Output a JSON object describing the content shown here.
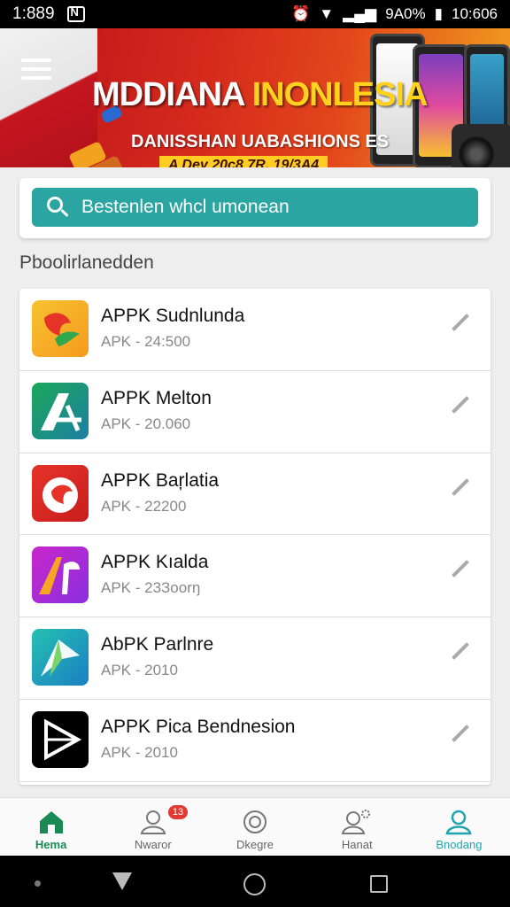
{
  "status_bar": {
    "time": "1:889",
    "battery_text": "9A0%",
    "clock_right": "10:606"
  },
  "banner": {
    "title_part1": "MDDIANA",
    "title_part2": "INONLESIA",
    "subtitle": "DANISSHAN UABASHIONS ES",
    "date_strip": "A Dey 20c8 7R. 19/3A4"
  },
  "search": {
    "placeholder": "Bestenlen whcl umonean",
    "icon": "search-icon"
  },
  "section_title": "Pboolirlanedden",
  "apps": [
    {
      "name": "APPK Sudnlunda",
      "meta": "APK - 24:500",
      "icon_colors": [
        "#f7c230",
        "#f59b1d"
      ]
    },
    {
      "name": "APPK Melton",
      "meta": "APK - 20.060",
      "icon_colors": [
        "#1ba85a",
        "#1d7fa2"
      ]
    },
    {
      "name": "APPK Baŗlatia",
      "meta": "APK - 22200",
      "icon_colors": [
        "#e63328",
        "#c81e1e"
      ]
    },
    {
      "name": "APPK Kıalda",
      "meta": "APK - 23Зoorŋ",
      "icon_colors": [
        "#c926c9",
        "#8a2fe0"
      ]
    },
    {
      "name": "AbPK Parlnre",
      "meta": "APK - 2010",
      "icon_colors": [
        "#25c0b0",
        "#1a7fc4"
      ]
    },
    {
      "name": "APPK Pica Bendnesion",
      "meta": "APK - 2010",
      "icon_colors": [
        "#000000",
        "#111111"
      ]
    }
  ],
  "bottom_nav": [
    {
      "label": "Hema",
      "icon": "home-icon"
    },
    {
      "label": "Nwaror",
      "icon": "user-badge-icon"
    },
    {
      "label": "Dkegre",
      "icon": "clock-icon"
    },
    {
      "label": "Hanat",
      "icon": "user-settings-icon"
    },
    {
      "label": "Bnodang",
      "icon": "user-icon"
    }
  ],
  "badge_count": "13",
  "colors": {
    "accent_teal": "#2aa5a2",
    "home_green": "#1a8a55",
    "badge_red": "#e23a33"
  }
}
